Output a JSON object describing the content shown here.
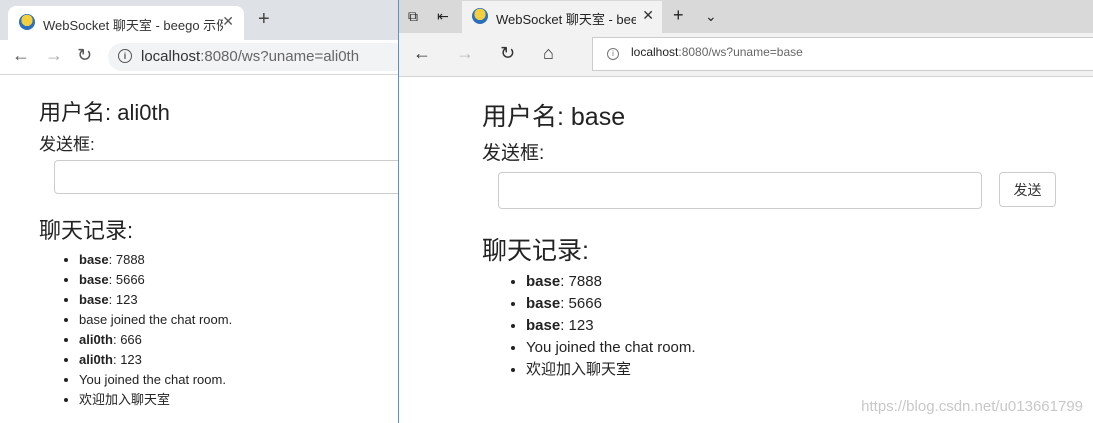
{
  "left_window": {
    "tab_title": "WebSocket 聊天室 - beego 示例",
    "url_host": "localhost",
    "url_path": ":8080/ws?uname=ali0th",
    "username_heading": "用户名: ali0th",
    "send_label": "发送框:",
    "chat_heading": "聊天记录:",
    "messages": [
      {
        "user": "base",
        "text": ": 7888"
      },
      {
        "user": "base",
        "text": ": 5666"
      },
      {
        "user": "base",
        "text": ": 123"
      },
      {
        "user": "",
        "text": "base joined the chat room."
      },
      {
        "user": "ali0th",
        "text": ": 666"
      },
      {
        "user": "ali0th",
        "text": ": 123"
      },
      {
        "user": "",
        "text": "You joined the chat room."
      },
      {
        "user": "",
        "text": "欢迎加入聊天室"
      }
    ]
  },
  "right_window": {
    "tab_title": "WebSocket 聊天室 - beego",
    "url_host": "localhost",
    "url_path": ":8080/ws?uname=base",
    "username_heading": "用户名: base",
    "send_label": "发送框:",
    "send_button": "发送",
    "chat_heading": "聊天记录:",
    "messages": [
      {
        "user": "base",
        "text": ": 7888"
      },
      {
        "user": "base",
        "text": ": 5666"
      },
      {
        "user": "base",
        "text": ": 123"
      },
      {
        "user": "",
        "text": "You joined the chat room."
      },
      {
        "user": "",
        "text": "欢迎加入聊天室"
      }
    ]
  },
  "watermark": "https://blog.csdn.net/u013661799"
}
